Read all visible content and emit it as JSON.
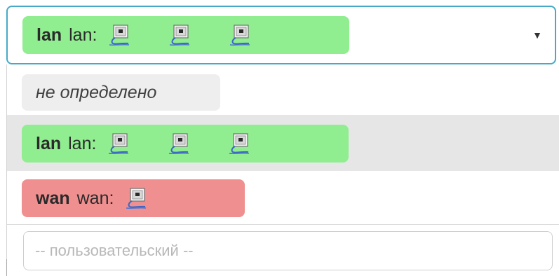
{
  "select": {
    "selected": {
      "zone": "lan",
      "label": "lan:",
      "port_count": 3,
      "color": "#90ee90"
    },
    "caret_icon": "triangle-down-icon",
    "caret_glyph": "▼"
  },
  "options": [
    {
      "type": "unspecified",
      "text": "не определено",
      "color": "#eeeeee"
    },
    {
      "type": "zone",
      "zone": "lan",
      "label": "lan:",
      "port_count": 3,
      "color": "#90ee90",
      "highlighted": true
    },
    {
      "type": "zone",
      "zone": "wan",
      "label": "wan:",
      "port_count": 1,
      "color": "#f08f8f"
    },
    {
      "type": "custom",
      "placeholder": "-- пользовательский --"
    }
  ],
  "icons": {
    "port": "ethernet-port-icon"
  },
  "colors": {
    "focus_border": "#45a9c7",
    "highlight_bg": "#e6e6e6"
  }
}
